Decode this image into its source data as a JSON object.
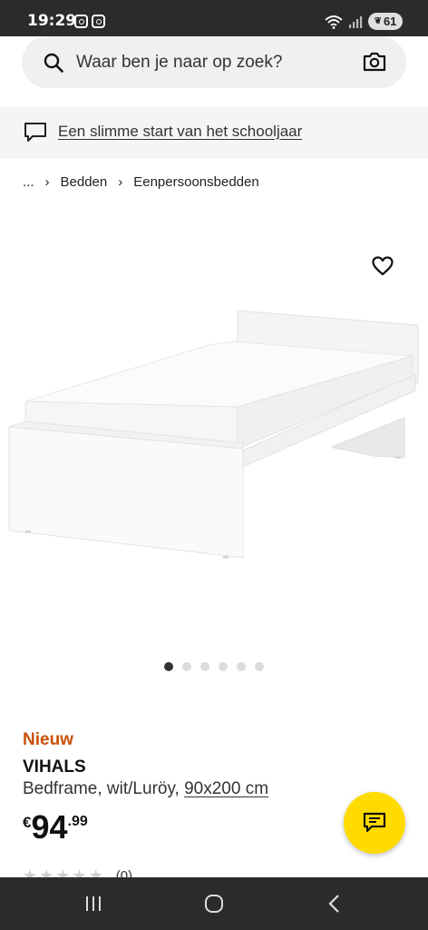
{
  "status_bar": {
    "time": "19:29",
    "battery": "61"
  },
  "search": {
    "placeholder": "Waar ben je naar op zoek?"
  },
  "promo": {
    "text": "Een slimme start van het schooljaar"
  },
  "breadcrumb": {
    "ellipsis": "...",
    "items": [
      "Bedden",
      "Eenpersoonsbedden"
    ]
  },
  "gallery": {
    "image_count": 6,
    "active_index": 0
  },
  "product": {
    "label": "Nieuw",
    "name": "VIHALS",
    "description": "Bedframe, wit/Luröy, ",
    "size": "90x200 cm",
    "price": {
      "currency": "€",
      "integer": "94",
      "decimal": ".99"
    },
    "rating": {
      "stars": 0,
      "max": 5,
      "count": "(0)"
    }
  },
  "colors": {
    "accent_new": "#ca5008",
    "fab": "#ffdb00",
    "system_bar": "#2b2b2b"
  }
}
